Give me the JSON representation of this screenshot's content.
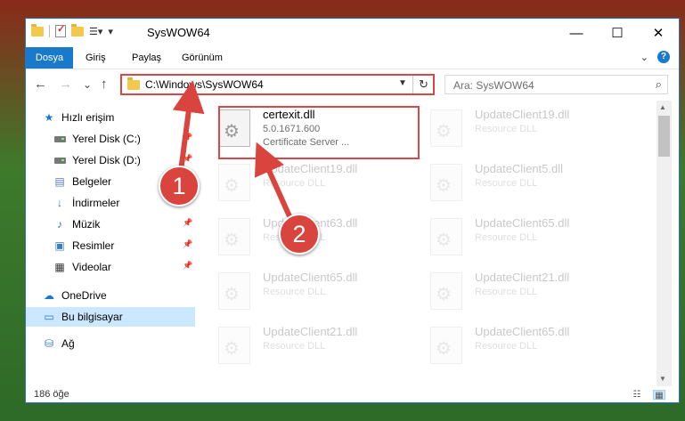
{
  "window": {
    "title": "SysWOW64",
    "controls": {
      "minimize": "—",
      "maximize": "☐",
      "close": "✕"
    }
  },
  "ribbon": {
    "tabs": [
      "Dosya",
      "Giriş",
      "Paylaş",
      "Görünüm"
    ],
    "help": "?"
  },
  "navigation": {
    "back": "←",
    "forward": "→",
    "recent": "⌄",
    "up": "↑",
    "address": "C:\\Windows\\SysWOW64",
    "refresh": "↻",
    "search_placeholder": "Ara: SysWOW64"
  },
  "sidebar": {
    "items": [
      {
        "label": "Hızlı erişim",
        "icon": "star-icon"
      },
      {
        "label": "Yerel Disk (C:)",
        "icon": "disk-icon"
      },
      {
        "label": "Yerel Disk (D:)",
        "icon": "disk-icon"
      },
      {
        "label": "Belgeler",
        "icon": "documents-icon"
      },
      {
        "label": "İndirmeler",
        "icon": "downloads-icon"
      },
      {
        "label": "Müzik",
        "icon": "music-icon"
      },
      {
        "label": "Resimler",
        "icon": "pictures-icon"
      },
      {
        "label": "Videolar",
        "icon": "videos-icon"
      },
      {
        "label": "OneDrive",
        "icon": "cloud-icon"
      },
      {
        "label": "Bu bilgisayar",
        "icon": "computer-icon",
        "selected": true
      },
      {
        "label": "Ağ",
        "icon": "network-icon"
      }
    ]
  },
  "files": {
    "col1": [
      {
        "name": "certexit.dll",
        "version": "5.0.1671.600",
        "desc": "Certificate Server ...",
        "highlighted": true
      },
      {
        "name": "UpdateClient19.dll",
        "desc": "Resource DLL"
      },
      {
        "name": "UpdateClient63.dll",
        "desc": "Resource DLL"
      },
      {
        "name": "UpdateClient65.dll",
        "desc": "Resource DLL"
      },
      {
        "name": "UpdateClient21.dll",
        "desc": "Resource DLL"
      }
    ],
    "col2": [
      {
        "name": "UpdateClient19.dll",
        "desc": "Resource DLL"
      },
      {
        "name": "UpdateClient5.dll",
        "desc": "Resource DLL"
      },
      {
        "name": "UpdateClient65.dll",
        "desc": "Resource DLL"
      },
      {
        "name": "UpdateClient21.dll",
        "desc": "Resource DLL"
      },
      {
        "name": "UpdateClient65.dll",
        "desc": "Resource DLL"
      }
    ]
  },
  "status": {
    "count": "186 öğe"
  },
  "annotations": {
    "step1": "1",
    "step2": "2",
    "color": "#d9443f"
  }
}
